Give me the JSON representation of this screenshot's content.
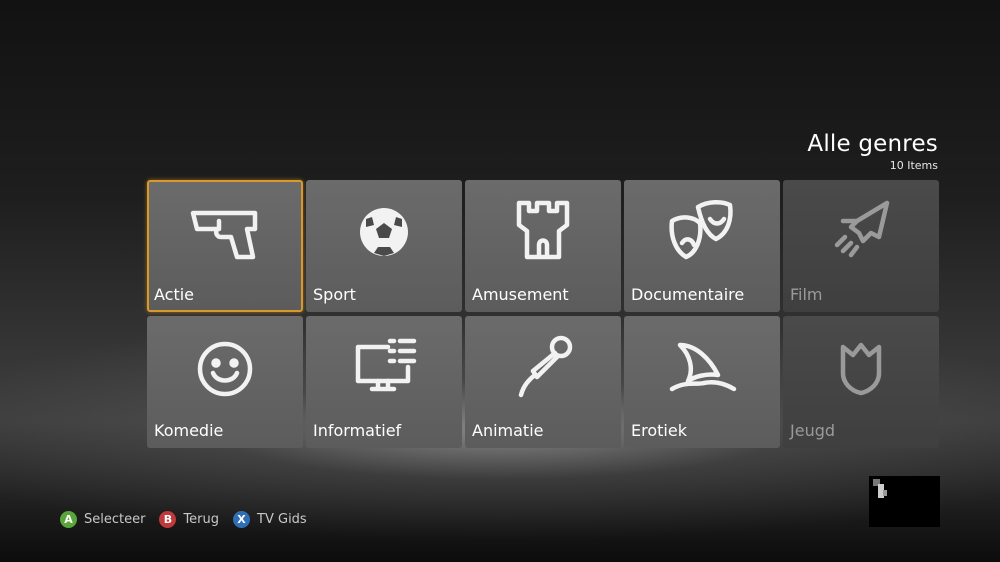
{
  "header": {
    "title": "Alle genres",
    "count": "10 Items"
  },
  "tiles": [
    {
      "label": "Actie",
      "icon": "pistol-icon",
      "selected": true,
      "enabled": true
    },
    {
      "label": "Sport",
      "icon": "soccer-ball-icon",
      "selected": false,
      "enabled": true
    },
    {
      "label": "Amusement",
      "icon": "tower-icon",
      "selected": false,
      "enabled": true
    },
    {
      "label": "Documentaire",
      "icon": "theater-masks-icon",
      "selected": false,
      "enabled": true
    },
    {
      "label": "Film",
      "icon": "rocket-icon",
      "selected": false,
      "enabled": false
    },
    {
      "label": "Komedie",
      "icon": "smiley-icon",
      "selected": false,
      "enabled": true
    },
    {
      "label": "Informatief",
      "icon": "monitor-list-icon",
      "selected": false,
      "enabled": true
    },
    {
      "label": "Animatie",
      "icon": "microphone-icon",
      "selected": false,
      "enabled": true
    },
    {
      "label": "Erotiek",
      "icon": "shark-fin-icon",
      "selected": false,
      "enabled": true
    },
    {
      "label": "Jeugd",
      "icon": "tulip-icon",
      "selected": false,
      "enabled": false
    }
  ],
  "hints": {
    "a": {
      "key": "A",
      "label": "Selecteer"
    },
    "b": {
      "key": "B",
      "label": "Terug"
    },
    "x": {
      "key": "X",
      "label": "TV Gids"
    }
  },
  "colors": {
    "selection": "#d9982a",
    "button_a": "#5aa53a",
    "button_b": "#c0393b",
    "button_x": "#2f6fb6"
  }
}
